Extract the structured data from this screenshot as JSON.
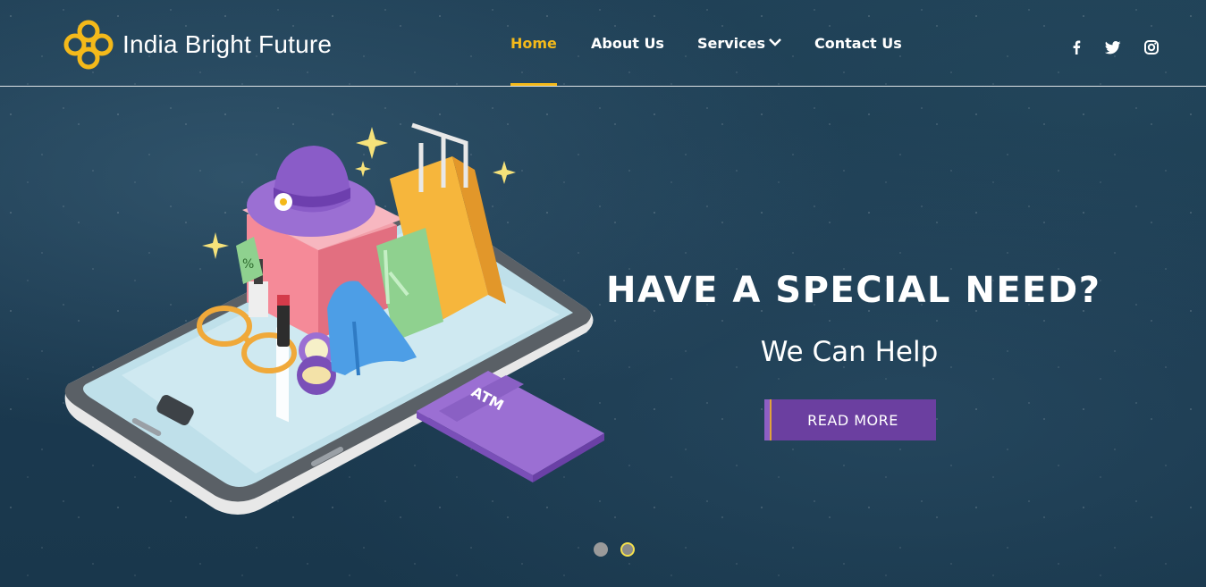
{
  "brand": {
    "name": "India Bright Future"
  },
  "nav": {
    "items": [
      {
        "label": "Home",
        "active": true
      },
      {
        "label": "About Us"
      },
      {
        "label": "Services",
        "has_dropdown": true
      },
      {
        "label": "Contact Us"
      }
    ]
  },
  "social": {
    "facebook": "f",
    "twitter": "twitter",
    "instagram": "instagram"
  },
  "hero": {
    "title": "HAVE A SPECIAL NEED?",
    "subtitle": "We Can Help",
    "cta": "READ MORE",
    "card_label": "ATM",
    "tag_label": "%"
  },
  "slider": {
    "count": 2,
    "active_index": 1
  },
  "colors": {
    "accent": "#f4b91a",
    "button": "#6b3fa0",
    "background": "#1c3a50"
  }
}
